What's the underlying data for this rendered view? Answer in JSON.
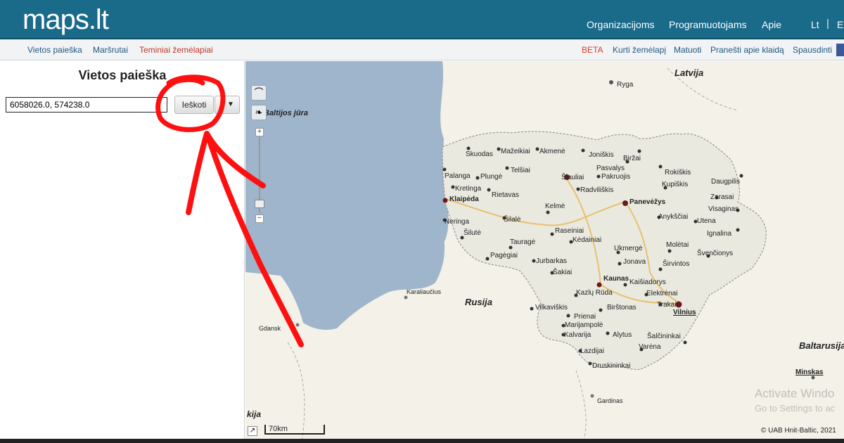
{
  "header": {
    "logo": "maps.lt",
    "nav": [
      "Organizacijoms",
      "Programuotojams",
      "Apie"
    ],
    "lang_lt": "Lt",
    "lang_sep": "|",
    "lang_e": "E"
  },
  "subbar": {
    "tabs": [
      "Vietos paieška",
      "Maršrutai",
      "Teminiai žemėlapiai"
    ],
    "beta": "BETA",
    "actions": [
      "Kurti žemėlapį",
      "Matuoti",
      "Pranešti apie klaidą",
      "Spausdinti"
    ]
  },
  "panel": {
    "title": "Vietos paieška",
    "search_value": "6058026.0, 574238.0",
    "search_button": "Ieškoti",
    "dropdown_icon": "caret-down-icon"
  },
  "map": {
    "countries": [
      "Latvija",
      "Rusija",
      "Baltarusija"
    ],
    "sea": "Baltijos jūra",
    "cities": [
      "Ryga",
      "Skuodas",
      "Mažeikiai",
      "Akmenė",
      "Joniškis",
      "Biržai",
      "Telšiai",
      "Pasvalys",
      "Rokiškis",
      "Daugpilis",
      "Palanga",
      "Plungė",
      "Šiauliai",
      "Pakruojis",
      "Kupiškis",
      "Zarasai",
      "Kretinga",
      "Rietavas",
      "Radviliškis",
      "Visaginas",
      "Klaipėda",
      "Panevėžys",
      "Kelmė",
      "Anykščiai",
      "Neringa",
      "Šilalė",
      "Utena",
      "Ignalina",
      "Šilutė",
      "Raseiniai",
      "Kėdainiai",
      "Tauragė",
      "Ukmergė",
      "Molėtai",
      "Švenčionys",
      "Pagėgiai",
      "Jurbarkas",
      "Jonava",
      "Širvintos",
      "Šakiai",
      "Karaliaučius",
      "Kaunas",
      "Kaišiadorys",
      "Kazlų Rūda",
      "Elektrėnai",
      "Trakai",
      "Vilnius",
      "Vilkaviškis",
      "Birštonas",
      "Prienai",
      "Gdansk",
      "Marijampolė",
      "Kalvarija",
      "Alytus",
      "Šalčininkai",
      "Varėna",
      "Lazdijai",
      "Druskininkai",
      "Minskas",
      "Gardinas",
      "kija"
    ],
    "scale": "70km",
    "copyright": "© UAB Hnit-Baltic, 2021",
    "watermark_line1": "Activate Windo",
    "watermark_line2": "Go to Settings to ac",
    "tool_icons": [
      "broom-icon",
      "lithuania-map-icon"
    ],
    "zoom_in": "+",
    "zoom_out": "−"
  }
}
